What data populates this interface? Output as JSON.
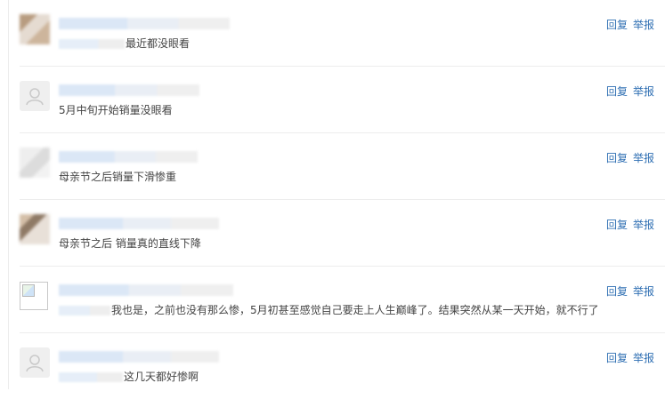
{
  "actions": {
    "reply": "回复",
    "report": "举报"
  },
  "comments": [
    {
      "text": "最近都没眼看"
    },
    {
      "text": "5月中旬开始销量没眼看"
    },
    {
      "text": "母亲节之后销量下滑惨重"
    },
    {
      "text": "母亲节之后 销量真的直线下降"
    },
    {
      "text": "我也是，之前也没有那么惨，5月初甚至感觉自己要走上人生巅峰了。结果突然从某一天开始，就不行了"
    },
    {
      "text": "这几天都好惨啊"
    }
  ]
}
